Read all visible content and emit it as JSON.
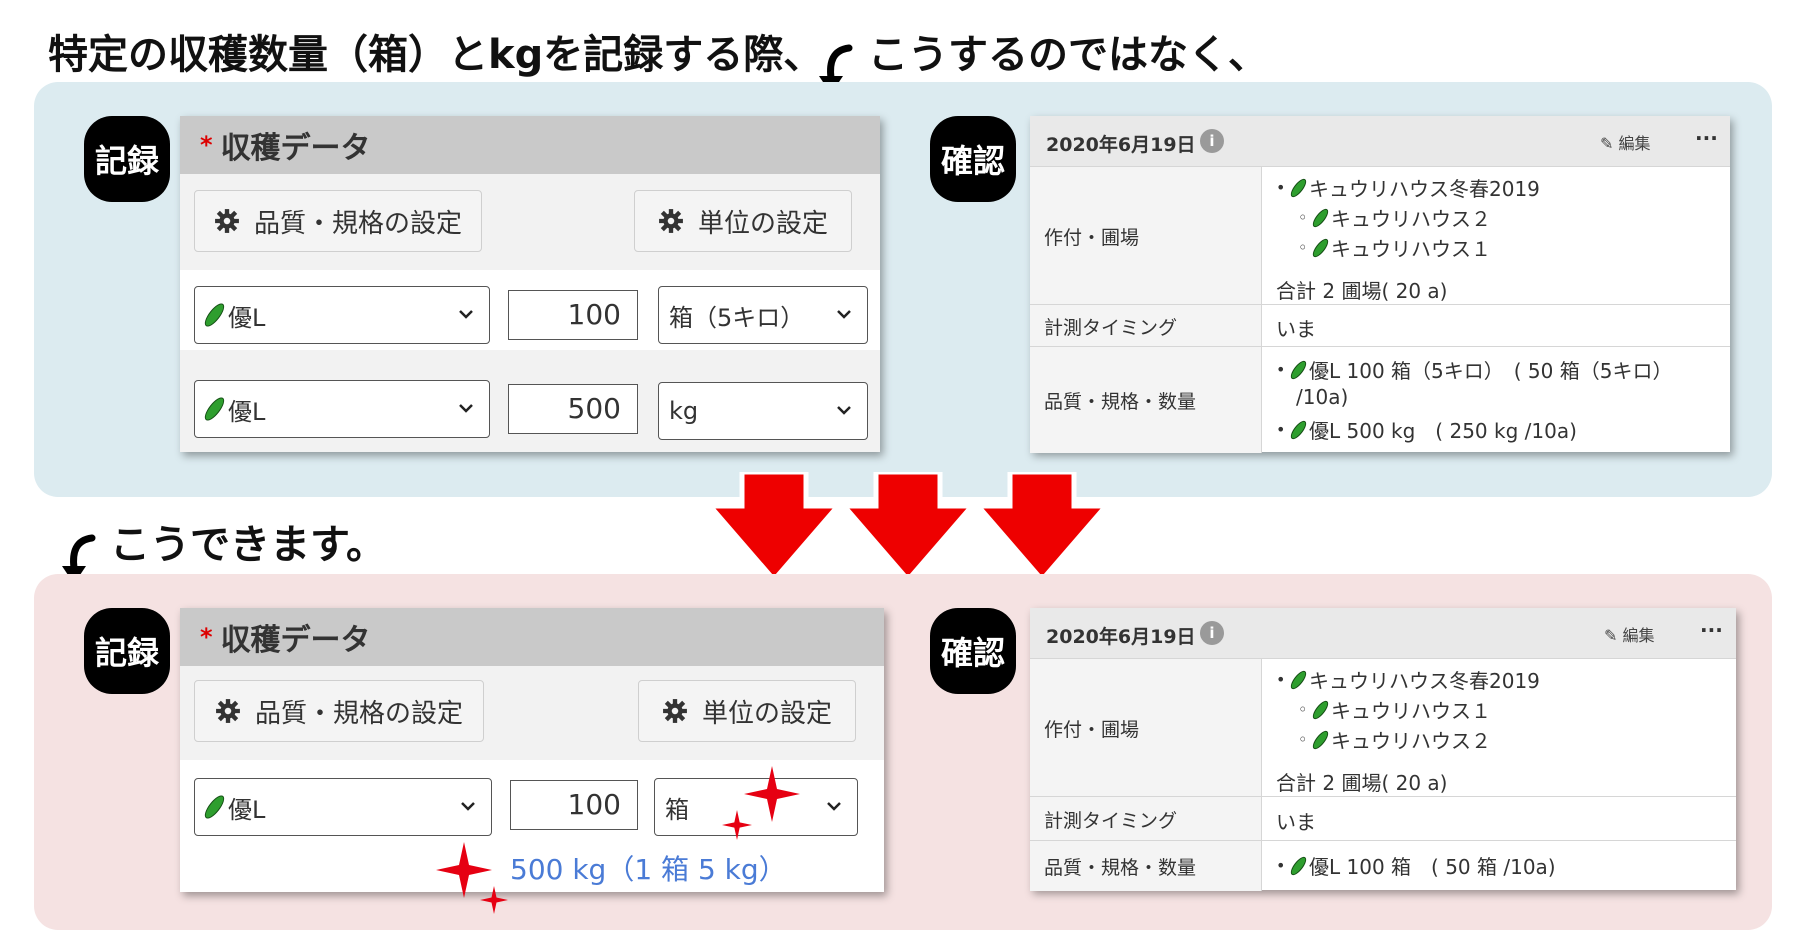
{
  "headings": {
    "top": "特定の収穫数量（箱）とkgを記録する際、",
    "top_right": "こうするのではなく、",
    "middle": "こうできます。"
  },
  "colors": {
    "top_panel": "#dcebf0",
    "bottom_panel": "#f5e2e2",
    "down_arrows": "#ee0000",
    "sparkle": "#e60012",
    "hint_text": "#4a7bd6"
  },
  "before": {
    "record_badge": "記録",
    "confirm_badge": "確認",
    "form": {
      "required_mark": "*",
      "title": "収穫データ",
      "quality_button": "品質・規格の設定",
      "unit_button": "単位の設定",
      "rows": [
        {
          "grade": "優L",
          "qty": "100",
          "unit": "箱（5キロ）"
        },
        {
          "grade": "優L",
          "qty": "500",
          "unit": "kg"
        }
      ]
    },
    "confirm": {
      "date": "2020年6月19日",
      "info": "i",
      "edit": "編集",
      "more": "···",
      "crop_label": "作付・圃場",
      "crop_main": "キュウリハウス冬春2019",
      "crop_sub1": "キュウリハウス２",
      "crop_sub2": "キュウリハウス１",
      "total": "合計 2 圃場( 20 a)",
      "timing_label": "計測タイミング",
      "timing_value": "いま",
      "quality_label": "品質・規格・数量",
      "quality_line1": "優L 100 箱（5キロ）　( 50 箱（5キロ）",
      "quality_line1b": "/10a)",
      "quality_line2": "優L 500 kg　( 250 kg /10a)"
    }
  },
  "after": {
    "record_badge": "記録",
    "confirm_badge": "確認",
    "form": {
      "required_mark": "*",
      "title": "収穫データ",
      "quality_button": "品質・規格の設定",
      "unit_button": "単位の設定",
      "row": {
        "grade": "優L",
        "qty": "100",
        "unit": "箱"
      },
      "conversion_hint": "500 kg（1 箱 5 kg）"
    },
    "confirm": {
      "date": "2020年6月19日",
      "info": "i",
      "edit": "編集",
      "more": "···",
      "crop_label": "作付・圃場",
      "crop_main": "キュウリハウス冬春2019",
      "crop_sub1": "キュウリハウス１",
      "crop_sub2": "キュウリハウス２",
      "total": "合計 2 圃場( 20 a)",
      "timing_label": "計測タイミング",
      "timing_value": "いま",
      "quality_label": "品質・規格・数量",
      "quality_line1": "優L 100 箱　( 50 箱 /10a)"
    }
  }
}
